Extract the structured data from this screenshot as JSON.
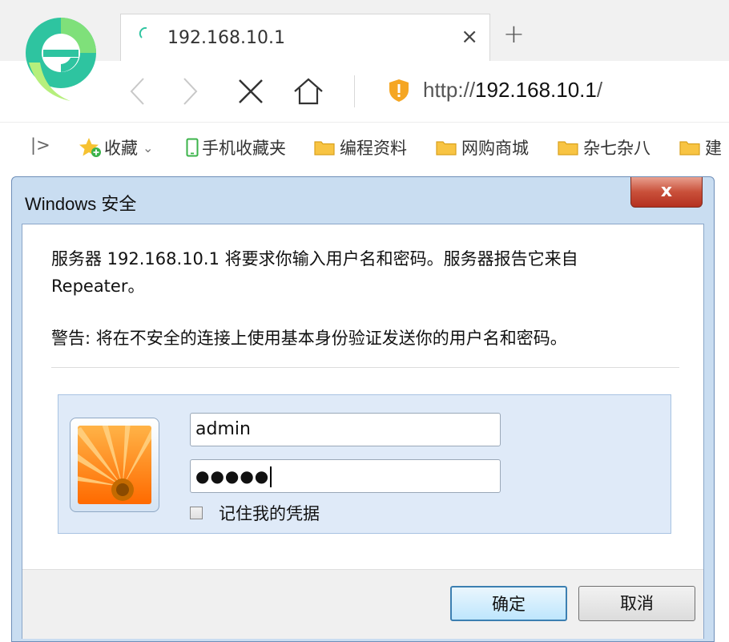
{
  "browser": {
    "tab_title": "192.168.10.1",
    "tab_close": "×",
    "new_tab": "+",
    "url_scheme": "http://",
    "url_host": "192.168.10.1",
    "url_trail": "/",
    "brand_color": "#2ec4a0"
  },
  "bookmarks": {
    "toggle": "|>",
    "favorites": "收藏",
    "favorites_caret": "⌄",
    "mobile": "手机收藏夹",
    "folders": [
      "编程资料",
      "网购商城",
      "杂七杂八",
      "建"
    ]
  },
  "dialog": {
    "title": "Windows 安全",
    "close": "x",
    "message": "服务器 192.168.10.1 将要求你输入用户名和密码。服务器报告它来自 Repeater。",
    "warning": "警告: 将在不安全的连接上使用基本身份验证发送你的用户名和密码。",
    "username": "admin",
    "password_mask": "●●●●●",
    "remember_label": "记住我的凭据",
    "remember_checked": false,
    "ok_label": "确定",
    "cancel_label": "取消"
  }
}
